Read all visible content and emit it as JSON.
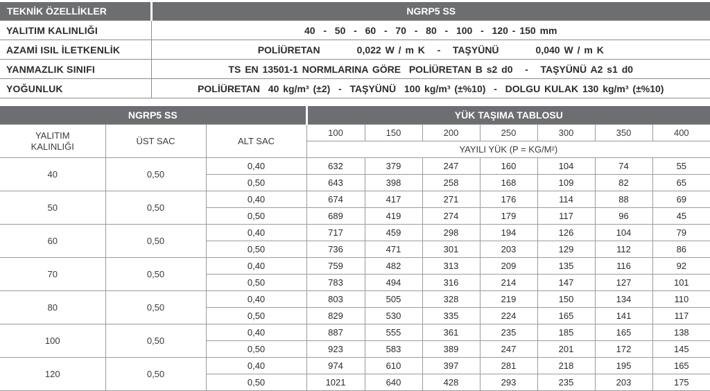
{
  "spec": {
    "header_left": "TEKNİK ÖZELLİKLER",
    "header_right": "NGRP5 SS",
    "rows": [
      {
        "label": "YALITIM KALINLIĞI",
        "value": "40  -  50  -  60  -  70  -  80  -  100  -  120 - 150 mm"
      },
      {
        "label": "AZAMİ ISIL İLETKENLİK",
        "value": "POLİÜRETAN         0,022 W / m K   -   TAŞYÜNÜ         0,040 W / m K"
      },
      {
        "label": "YANMAZLIK SINIFI",
        "value": "TS EN 13501-1 NORMLARINA GÖRE  POLİÜRETAN B s2 d0   -   TAŞYÜNÜ A2 s1 d0"
      },
      {
        "label": "YOĞUNLUK",
        "value": "POLİÜRETAN  40 kg/m³ (±2)  -  TAŞYÜNÜ  100 kg/m³ (±%10)  -  DOLGU KULAK 130 kg/m³ (±%10)"
      }
    ]
  },
  "load": {
    "header_left": "NGRP5 SS",
    "header_right": "YÜK TAŞIMA TABLOSU",
    "col_thickness": "YALITIM KALINLIĞI",
    "col_top": "ÜST SAC",
    "col_bottom": "ALT SAC",
    "spans": [
      "100",
      "150",
      "200",
      "250",
      "300",
      "350",
      "400"
    ],
    "load_unit": "YAYILI YÜK (P = KG/M²)",
    "groups": [
      {
        "thickness": "40",
        "top": "0,50",
        "rows": [
          {
            "bottom": "0,40",
            "values": [
              "632",
              "379",
              "247",
              "160",
              "104",
              "74",
              "55"
            ]
          },
          {
            "bottom": "0,50",
            "values": [
              "643",
              "398",
              "258",
              "168",
              "109",
              "82",
              "65"
            ]
          }
        ]
      },
      {
        "thickness": "50",
        "top": "0,50",
        "rows": [
          {
            "bottom": "0,40",
            "values": [
              "674",
              "417",
              "271",
              "176",
              "114",
              "88",
              "69"
            ]
          },
          {
            "bottom": "0,50",
            "values": [
              "689",
              "419",
              "274",
              "179",
              "117",
              "96",
              "45"
            ]
          }
        ]
      },
      {
        "thickness": "60",
        "top": "0,50",
        "rows": [
          {
            "bottom": "0,40",
            "values": [
              "717",
              "459",
              "298",
              "194",
              "126",
              "104",
              "79"
            ]
          },
          {
            "bottom": "0,50",
            "values": [
              "736",
              "471",
              "301",
              "203",
              "129",
              "112",
              "86"
            ]
          }
        ]
      },
      {
        "thickness": "70",
        "top": "0,50",
        "rows": [
          {
            "bottom": "0,40",
            "values": [
              "759",
              "482",
              "313",
              "209",
              "135",
              "116",
              "92"
            ]
          },
          {
            "bottom": "0,50",
            "values": [
              "783",
              "494",
              "316",
              "214",
              "147",
              "127",
              "101"
            ]
          }
        ]
      },
      {
        "thickness": "80",
        "top": "0,50",
        "rows": [
          {
            "bottom": "0,40",
            "values": [
              "803",
              "505",
              "328",
              "219",
              "150",
              "134",
              "110"
            ]
          },
          {
            "bottom": "0,50",
            "values": [
              "829",
              "530",
              "335",
              "224",
              "165",
              "141",
              "117"
            ]
          }
        ]
      },
      {
        "thickness": "100",
        "top": "0,50",
        "rows": [
          {
            "bottom": "0,40",
            "values": [
              "887",
              "555",
              "361",
              "235",
              "185",
              "165",
              "138"
            ]
          },
          {
            "bottom": "0,50",
            "values": [
              "923",
              "583",
              "389",
              "247",
              "201",
              "172",
              "145"
            ]
          }
        ]
      },
      {
        "thickness": "120",
        "top": "0,50",
        "rows": [
          {
            "bottom": "0,40",
            "values": [
              "974",
              "610",
              "397",
              "281",
              "218",
              "195",
              "165"
            ]
          },
          {
            "bottom": "0,50",
            "values": [
              "1021",
              "640",
              "428",
              "293",
              "235",
              "203",
              "175"
            ]
          }
        ]
      }
    ]
  },
  "colors": {
    "header_bg": "#6d6e71",
    "header_text": "#ffffff",
    "border": "#9a9a9a",
    "text": "#2b2b2b"
  }
}
